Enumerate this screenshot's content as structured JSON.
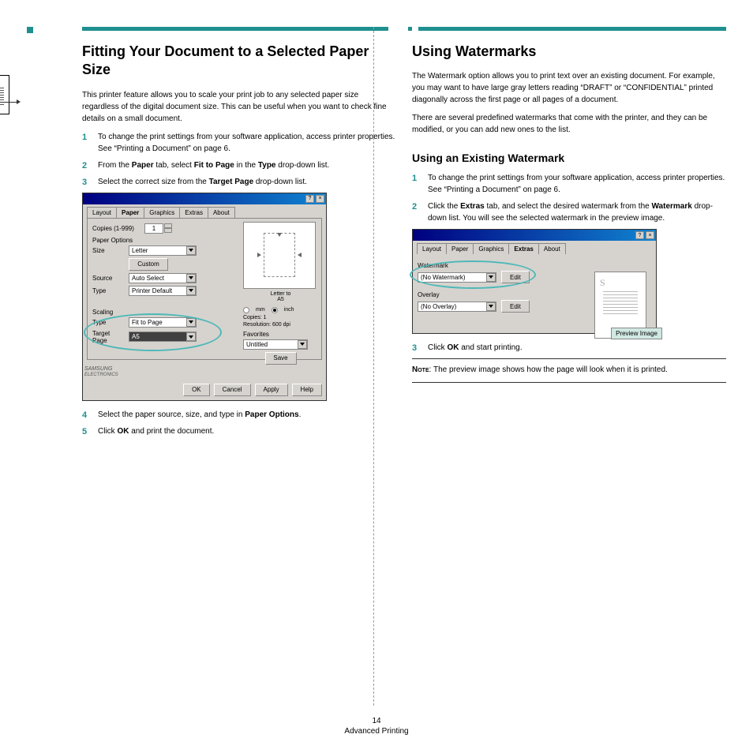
{
  "left": {
    "heading": "Fitting Your Document to a Selected Paper Size",
    "intro": "This printer feature allows you to scale your print job to any selected paper size regardless of the digital document size. This can be useful when you want to check fine details on a small document.",
    "steps_a": [
      {
        "pre": "To change the print settings from your software application, access printer properties. See “Printing a Document” on page 6."
      },
      {
        "pre": "From the ",
        "b1": "Paper",
        "mid1": " tab, select ",
        "b2": "Fit to Page",
        "mid2": " in the ",
        "b3": "Type",
        "post": " drop-down list."
      },
      {
        "pre": "Select the correct size from the ",
        "b1": "Target Page",
        "post": " drop-down list."
      }
    ],
    "steps_b": [
      {
        "pre": "Select the paper source, size, and type in ",
        "b1": "Paper Options",
        "post": "."
      },
      {
        "pre": "Click ",
        "b1": "OK",
        "post": " and print the document."
      }
    ],
    "dialog1": {
      "tabs": [
        "Layout",
        "Paper",
        "Graphics",
        "Extras",
        "About"
      ],
      "active_tab": "Paper",
      "copies_label": "Copies (1-999)",
      "copies_value": "1",
      "paper_options": "Paper Options",
      "size_label": "Size",
      "size_value": "Letter",
      "custom_btn": "Custom",
      "source_label": "Source",
      "source_value": "Auto Select",
      "type_label": "Type",
      "type_value": "Printer Default",
      "scaling_label": "Scaling",
      "scaling_type_label": "Type",
      "scaling_type_value": "Fit to Page",
      "target_page_label": "Target Page",
      "target_page_value": "A5",
      "preview_text1": "Letter to",
      "preview_text2": "A5",
      "unit_mm": "mm",
      "unit_inch": "inch",
      "copies_info": "Copies: 1",
      "resolution": "Resolution: 600 dpi",
      "favorites": "Favorites",
      "favorites_value": "Untitled",
      "save_btn": "Save",
      "logo1": "SAMSUNG",
      "logo2": "ELECTRONICS",
      "buttons": [
        "OK",
        "Cancel",
        "Apply",
        "Help"
      ]
    }
  },
  "right": {
    "heading": "Using Watermarks",
    "para1": "The Watermark option allows you to print text over an existing document. For example, you may want to have large gray letters reading “DRAFT” or “CONFIDENTIAL” printed diagonally across the first page or all pages of a document.",
    "para2": "There are several predefined watermarks that come with the printer, and they can be modified, or you can add new ones to the list.",
    "subheading": "Using an Existing Watermark",
    "steps_a": [
      {
        "pre": "To change the print settings from your software application, access printer properties. See “Printing a Document” on page 6."
      },
      {
        "pre": "Click the ",
        "b1": "Extras",
        "mid1": " tab, and select the desired watermark from the ",
        "b2": "Watermark",
        "post": " drop-down list. You will see the selected watermark in the preview image."
      }
    ],
    "steps_b": [
      {
        "pre": "Click ",
        "b1": "OK",
        "post": " and start printing."
      }
    ],
    "dialog2": {
      "tabs": [
        "Layout",
        "Paper",
        "Graphics",
        "Extras",
        "About"
      ],
      "active_tab": "Extras",
      "watermark_label": "Watermark",
      "watermark_value": "(No Watermark)",
      "overlay_label": "Overlay",
      "overlay_value": "(No Overlay)",
      "edit_btn": "Edit",
      "callout": "Preview Image",
      "s": "S"
    },
    "note_label": "Note",
    "note_text": ": The preview image shows how the page will look when it is printed."
  },
  "footer": {
    "page": "14",
    "section": "Advanced Printing"
  }
}
